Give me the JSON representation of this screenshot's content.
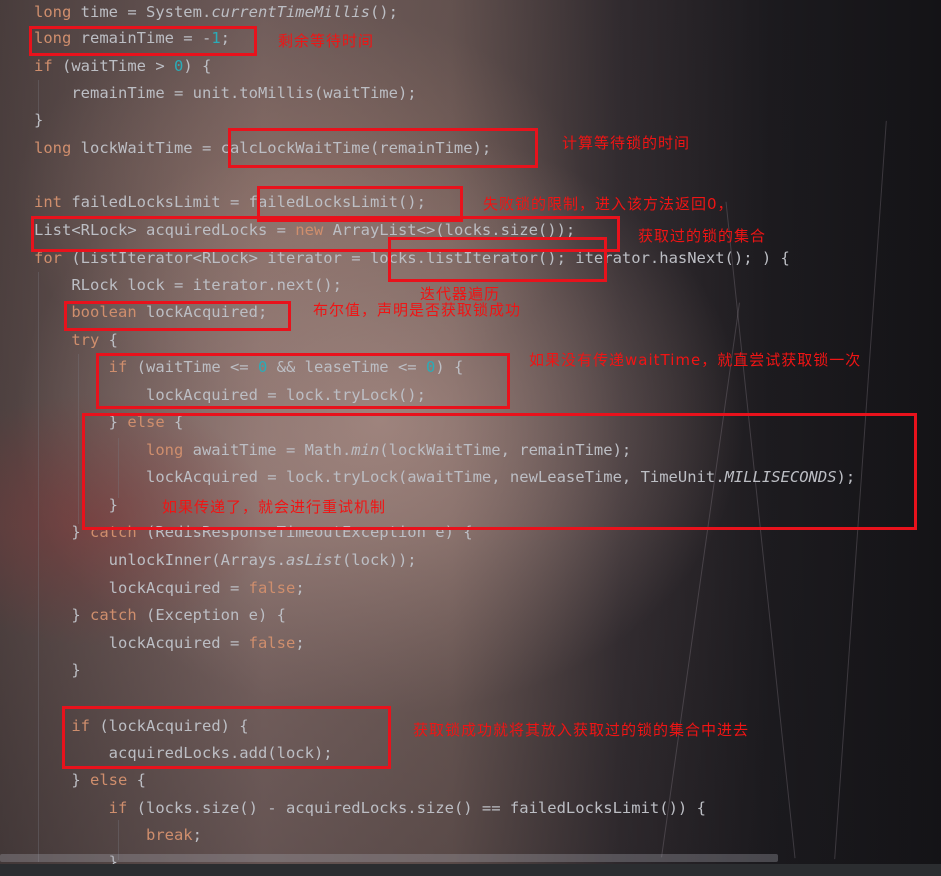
{
  "code_lines": [
    {
      "id": "l1",
      "text": "long time = System.currentTimeMillis();"
    },
    {
      "id": "l2",
      "text": "long remainTime = -1;"
    },
    {
      "id": "l3",
      "text": "if (waitTime > 0) {"
    },
    {
      "id": "l4",
      "text": "    remainTime = unit.toMillis(waitTime);"
    },
    {
      "id": "l5",
      "text": "}"
    },
    {
      "id": "l6",
      "text": "long lockWaitTime = calcLockWaitTime(remainTime);"
    },
    {
      "id": "l7",
      "text": ""
    },
    {
      "id": "l8",
      "text": "int failedLocksLimit = failedLocksLimit();"
    },
    {
      "id": "l9",
      "text": "List<RLock> acquiredLocks = new ArrayList<>(locks.size());"
    },
    {
      "id": "l10",
      "text": "for (ListIterator<RLock> iterator = locks.listIterator(); iterator.hasNext(); ) {"
    },
    {
      "id": "l11",
      "text": "    RLock lock = iterator.next();"
    },
    {
      "id": "l12",
      "text": "    boolean lockAcquired;"
    },
    {
      "id": "l13",
      "text": "    try {"
    },
    {
      "id": "l14",
      "text": "        if (waitTime <= 0 && leaseTime <= 0) {"
    },
    {
      "id": "l15",
      "text": "            lockAcquired = lock.tryLock();"
    },
    {
      "id": "l16",
      "text": "        } else {"
    },
    {
      "id": "l17",
      "text": "            long awaitTime = Math.min(lockWaitTime, remainTime);"
    },
    {
      "id": "l18",
      "text": "            lockAcquired = lock.tryLock(awaitTime, newLeaseTime, TimeUnit.MILLISECONDS);"
    },
    {
      "id": "l19",
      "text": "        }"
    },
    {
      "id": "l20",
      "text": "    } catch (RedisResponseTimeoutException e) {"
    },
    {
      "id": "l21",
      "text": "        unlockInner(Arrays.asList(lock));"
    },
    {
      "id": "l22",
      "text": "        lockAcquired = false;"
    },
    {
      "id": "l23",
      "text": "    } catch (Exception e) {"
    },
    {
      "id": "l24",
      "text": "        lockAcquired = false;"
    },
    {
      "id": "l25",
      "text": "    }"
    },
    {
      "id": "l26",
      "text": ""
    },
    {
      "id": "l27",
      "text": "    if (lockAcquired) {"
    },
    {
      "id": "l28",
      "text": "        acquiredLocks.add(lock);"
    },
    {
      "id": "l29",
      "text": "    } else {"
    },
    {
      "id": "l30",
      "text": "        if (locks.size() - acquiredLocks.size() == failedLocksLimit()) {"
    },
    {
      "id": "l31",
      "text": "            break;"
    },
    {
      "id": "l32",
      "text": "        }"
    }
  ],
  "annotations": {
    "remain_time": "剩余等待时间",
    "calc_wait": "计算等待锁的时间",
    "failed_limit": "失败锁的限制，进入该方法返回0，",
    "acquired_set": "获取过的锁的集合",
    "iterator": "迭代器遍历",
    "boolean_flag": "布尔值，声明是否获取锁成功",
    "no_wait": "如果没有传递waitTime，就直尝试获取锁一次",
    "retry": "如果传递了，就会进行重试机制",
    "add_success": "获取锁成功就将其放入获取过的锁的集合中进去"
  },
  "colors": {
    "annotation": "#f01414",
    "box": "#e8121c",
    "keyword": "#cf8e6d",
    "field": "#c77dbb",
    "number": "#2aacb8",
    "method": "#56a8f5",
    "text": "#bcbec4"
  }
}
